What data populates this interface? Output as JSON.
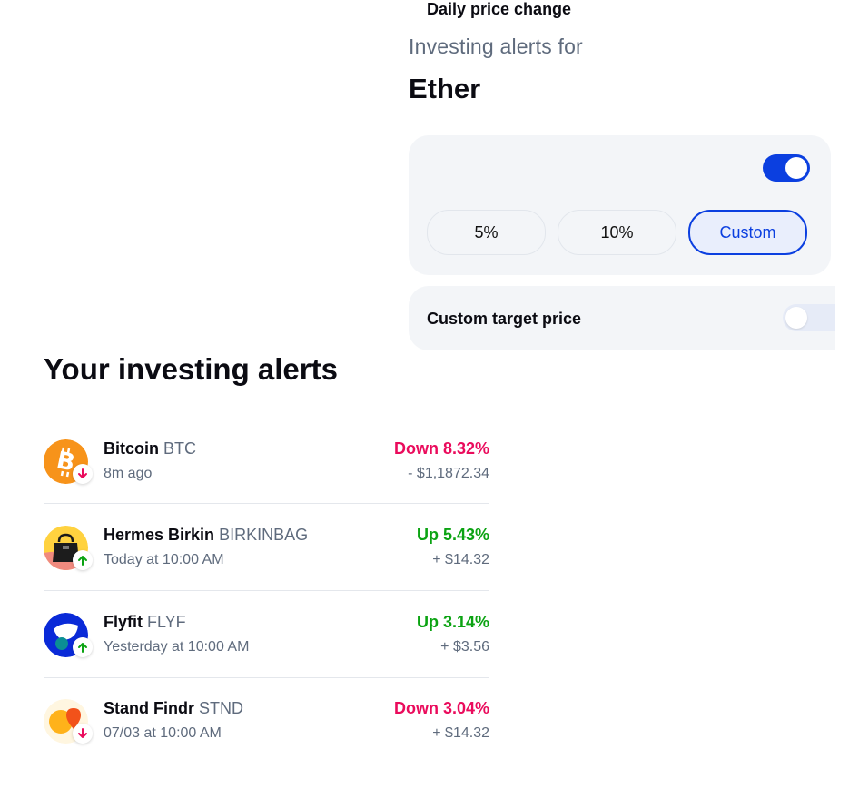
{
  "panel": {
    "subtitle": "Investing alerts for",
    "asset": "Ether",
    "daily_price_change": {
      "label": "Daily price change",
      "enabled": true,
      "options": [
        "5%",
        "10%",
        "Custom"
      ],
      "selected": "Custom"
    },
    "custom_target_price": {
      "label": "Custom target price",
      "enabled": false
    }
  },
  "alerts": {
    "title": "Your investing alerts",
    "items": [
      {
        "name": "Bitcoin",
        "ticker": "BTC",
        "time": "8m ago",
        "change": "Down 8.32%",
        "amount": "- $1,1872.34",
        "direction": "down"
      },
      {
        "name": "Hermes Birkin",
        "ticker": "BIRKINBAG",
        "time": "Today at 10:00 AM",
        "change": "Up 5.43%",
        "amount": "+ $14.32",
        "direction": "up"
      },
      {
        "name": "Flyfit",
        "ticker": "FLYF",
        "time": "Yesterday at 10:00 AM",
        "change": "Up 3.14%",
        "amount": "+ $3.56",
        "direction": "up"
      },
      {
        "name": "Stand Findr",
        "ticker": "STND",
        "time": "07/03 at 10:00 AM",
        "change": "Down 3.04%",
        "amount": "+ $14.32",
        "direction": "down"
      }
    ]
  },
  "colors": {
    "accent": "#0b3fe0",
    "down": "#ea0b5c",
    "up": "#0ba312",
    "muted": "#5f6b7d",
    "card_bg": "#f3f5f8"
  },
  "icons": {
    "bitcoin": "bitcoin-logo",
    "hermes": "handbag-logo",
    "flyfit": "flyfit-logo",
    "standfindr": "standfindr-logo",
    "down": "arrow-down-icon",
    "up": "arrow-up-icon"
  }
}
